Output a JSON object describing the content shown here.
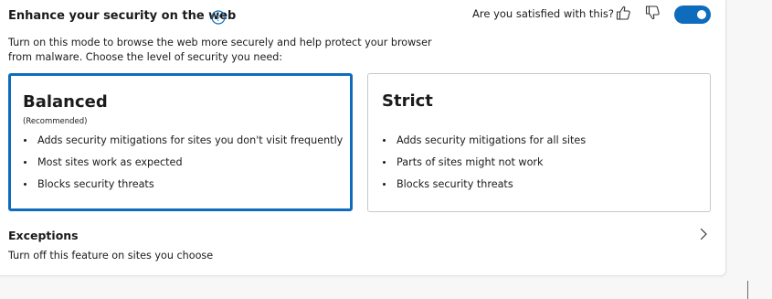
{
  "header": {
    "title": "Enhance your security on the web",
    "help_icon": "help-circle-icon",
    "feedback_question": "Are you satisfied with this?",
    "thumbs_up_icon": "thumbs-up-icon",
    "thumbs_down_icon": "thumbs-down-icon",
    "toggle_state": "on"
  },
  "description": "Turn on this mode to browse the web more securely and help protect your browser from malware. Choose the level of security you need:",
  "modes": [
    {
      "name": "Balanced",
      "subtitle": "(Recommended)",
      "selected": true,
      "bullets": [
        "Adds security mitigations for sites you don't visit frequently",
        "Most sites work as expected",
        "Blocks security threats"
      ]
    },
    {
      "name": "Strict",
      "selected": false,
      "bullets": [
        "Adds security mitigations for all sites",
        "Parts of sites might not work",
        "Blocks security threats"
      ]
    }
  ],
  "exceptions": {
    "title": "Exceptions",
    "description": "Turn off this feature on sites you choose",
    "chevron_icon": "chevron-right-icon"
  },
  "colors": {
    "accent": "#0f6cbd",
    "text": "#1b1b1b",
    "card_border": "#c8c8c8"
  }
}
